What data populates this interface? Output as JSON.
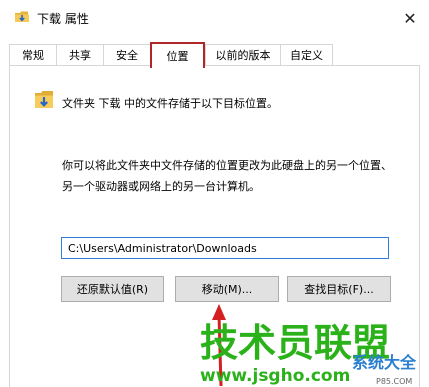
{
  "window": {
    "title": "下载 属性",
    "close_glyph": "✕"
  },
  "tabs": [
    {
      "label": "常规"
    },
    {
      "label": "共享"
    },
    {
      "label": "安全"
    },
    {
      "label": "位置",
      "active": true
    },
    {
      "label": "以前的版本"
    },
    {
      "label": "自定义"
    }
  ],
  "location": {
    "info": "文件夹 下载 中的文件存储于以下目标位置。",
    "description": "你可以将此文件夹中文件存储的位置更改为此硬盘上的另一个位置、另一个驱动器或网络上的另一台计算机。",
    "path_value": "C:\\Users\\Administrator\\Downloads"
  },
  "buttons": {
    "restore_default": "还原默认值(R)",
    "move": "移动(M)...",
    "find_target": "查找目标(F)..."
  },
  "watermark": {
    "line1": "技术员联盟",
    "line2": "www.jsgho.com",
    "line3": "系统大全",
    "line4": "P85.COM"
  },
  "colors": {
    "highlight": "#b0272a",
    "input_border": "#2f7fd6",
    "watermark": "#2bb21b"
  }
}
